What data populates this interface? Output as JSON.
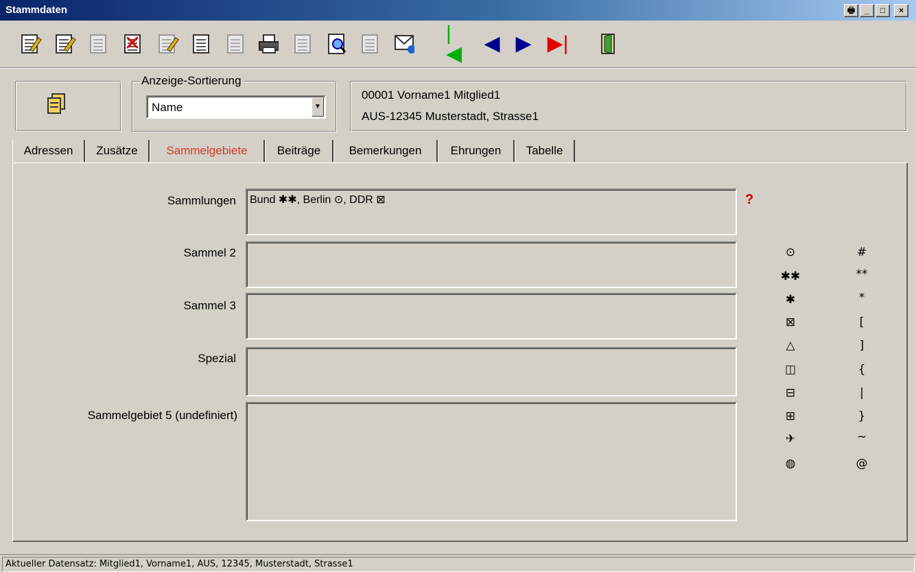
{
  "window": {
    "title": "Stammdaten",
    "buttons": [
      "🖶",
      "_",
      "□",
      "×"
    ]
  },
  "toolbar": {
    "tools": [
      {
        "name": "edit-record-icon"
      },
      {
        "name": "new-record-icon"
      },
      {
        "name": "copy-record-icon"
      },
      {
        "name": "delete-record-icon"
      },
      {
        "name": "edit-note-icon"
      },
      {
        "name": "list-view-icon"
      },
      {
        "name": "export-icon"
      },
      {
        "name": "print-icon"
      },
      {
        "name": "report-icon"
      },
      {
        "name": "preview-icon"
      },
      {
        "name": "document-icon"
      },
      {
        "name": "email-icon"
      },
      {
        "name": "first-record-icon",
        "glyph": "|◀",
        "color": "#00b000"
      },
      {
        "name": "previous-record-icon",
        "glyph": "◀",
        "color": "#000090"
      },
      {
        "name": "next-record-icon",
        "glyph": "▶",
        "color": "#000090"
      },
      {
        "name": "last-record-icon",
        "glyph": "▶|",
        "color": "#e00000"
      },
      {
        "name": "exit-door-icon"
      }
    ]
  },
  "sort": {
    "legend": "Anzeige-Sortierung",
    "value": "Name"
  },
  "record": {
    "line1": "00001 Vorname1 Mitglied1",
    "line2": "AUS-12345 Musterstadt, Strasse1"
  },
  "tabs": [
    {
      "label": "Adressen",
      "active": false
    },
    {
      "label": "Zusätze",
      "active": false
    },
    {
      "label": "Sammelgebiete",
      "active": true
    },
    {
      "label": "Beiträge",
      "active": false
    },
    {
      "label": "Bemerkungen",
      "active": false
    },
    {
      "label": "Ehrungen",
      "active": false
    },
    {
      "label": "Tabelle",
      "active": false
    }
  ],
  "fields": [
    {
      "label": "Sammlungen",
      "value": "Bund ✱✱, Berlin ⊙, DDR ⊠"
    },
    {
      "label": "Sammel 2",
      "value": ""
    },
    {
      "label": "Sammel 3",
      "value": ""
    },
    {
      "label": "Spezial",
      "value": ""
    },
    {
      "label": "Sammelgebiet 5 (undefiniert)",
      "value": ""
    }
  ],
  "help": "?",
  "symbols": {
    "left": [
      "⊙",
      "✱✱",
      "✱",
      "⊠",
      "△",
      "◫",
      "⊟",
      "⊞",
      "✈",
      "◍"
    ],
    "right": [
      "#",
      "**",
      "*",
      "[",
      "]",
      "{",
      "|",
      "}",
      "~",
      "@"
    ]
  },
  "status": "Aktueller Datensatz: Mitglied1, Vorname1, AUS, 12345, Musterstadt, Strasse1"
}
